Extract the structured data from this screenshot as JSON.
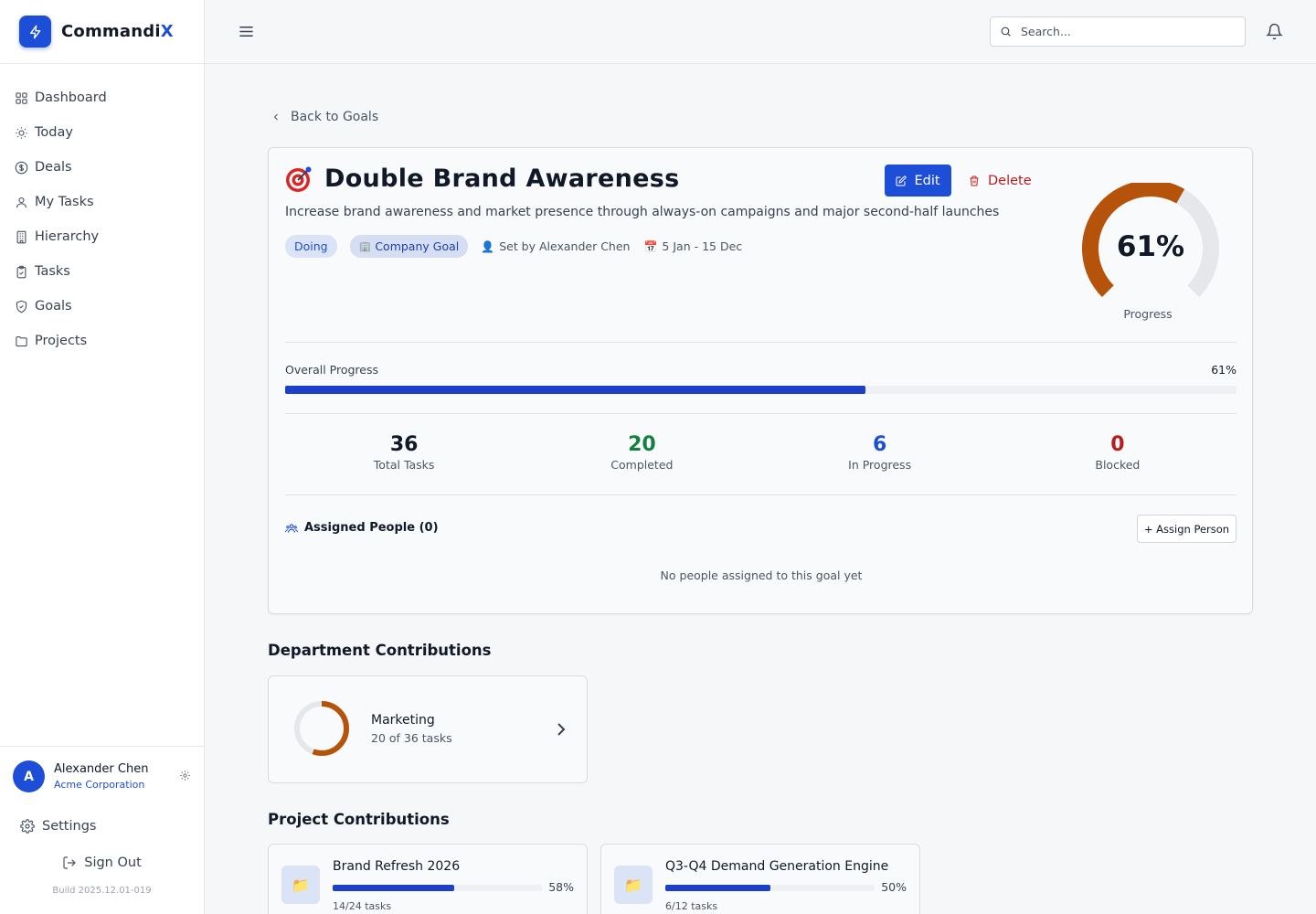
{
  "brand": {
    "name_main": "Commandi",
    "name_accent": "X"
  },
  "nav": [
    {
      "id": "dashboard",
      "label": "Dashboard",
      "icon": "grid-icon"
    },
    {
      "id": "today",
      "label": "Today",
      "icon": "sun-icon"
    },
    {
      "id": "deals",
      "label": "Deals",
      "icon": "dollar-icon"
    },
    {
      "id": "my-tasks",
      "label": "My Tasks",
      "icon": "user-icon"
    },
    {
      "id": "hierarchy",
      "label": "Hierarchy",
      "icon": "building-icon"
    },
    {
      "id": "tasks",
      "label": "Tasks",
      "icon": "clipboard-icon"
    },
    {
      "id": "goals",
      "label": "Goals",
      "icon": "shield-check-icon"
    },
    {
      "id": "projects",
      "label": "Projects",
      "icon": "folder-icon"
    }
  ],
  "user": {
    "initial": "A",
    "name": "Alexander Chen",
    "org": "Acme Corporation"
  },
  "footer": {
    "settings_label": "Settings",
    "signout_label": "Sign Out",
    "build": "Build 2025.12.01-019"
  },
  "topbar": {
    "search_placeholder": "Search..."
  },
  "back_label": "Back to Goals",
  "goal": {
    "icon": "target-icon",
    "title": "Double Brand Awareness",
    "edit_label": "Edit",
    "delete_label": "Delete",
    "description": "Increase brand awareness and market presence through always-on campaigns and major second-half launches",
    "status": "Doing",
    "type": "Company Goal",
    "set_by": "Set by Alexander Chen",
    "date_range": "5 Jan - 15 Dec",
    "progress_percent": 61,
    "progress_text": "61%",
    "progress_label": "Progress",
    "overall_label": "Overall Progress",
    "colors": {
      "gauge": "#b45309",
      "bar": "#1d40c8",
      "primary": "#1d4ed8"
    }
  },
  "stats": [
    {
      "value": "36",
      "label": "Total Tasks",
      "tone": ""
    },
    {
      "value": "20",
      "label": "Completed",
      "tone": "green"
    },
    {
      "value": "6",
      "label": "In Progress",
      "tone": "blue"
    },
    {
      "value": "0",
      "label": "Blocked",
      "tone": "red"
    }
  ],
  "assigned": {
    "title": "Assigned People (0)",
    "button": "+ Assign Person",
    "empty": "No people assigned to this goal yet"
  },
  "department_section": {
    "title": "Department Contributions"
  },
  "departments": [
    {
      "name": "Marketing",
      "subtitle": "20 of 36 tasks",
      "completed": 20,
      "total": 36
    }
  ],
  "project_section": {
    "title": "Project Contributions"
  },
  "projects": [
    {
      "name": "Brand Refresh 2026",
      "percent": 58,
      "percent_text": "58%",
      "tasks": "14/24 tasks"
    },
    {
      "name": "Q3-Q4 Demand Generation Engine",
      "percent": 50,
      "percent_text": "50%",
      "tasks": "6/12 tasks"
    }
  ]
}
